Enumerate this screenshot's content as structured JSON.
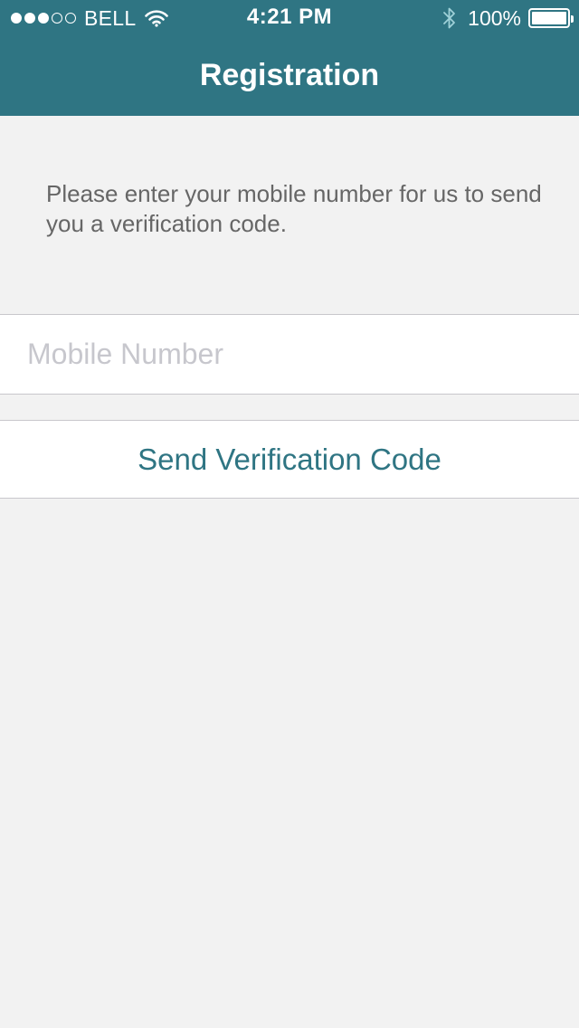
{
  "status_bar": {
    "carrier": "BELL",
    "time": "4:21 PM",
    "battery_percent": "100%",
    "signal_strength": 3,
    "signal_total": 5,
    "battery_level": 1.0,
    "icons": [
      "signal-dots-icon",
      "wifi-icon",
      "bluetooth-icon",
      "battery-icon"
    ]
  },
  "nav": {
    "title": "Registration"
  },
  "instruction": {
    "text": "Please enter your mobile number for us to send you a verification code."
  },
  "form": {
    "mobile_placeholder": "Mobile Number",
    "mobile_value": ""
  },
  "actions": {
    "send_label": "Send Verification Code"
  },
  "colors": {
    "header_bg": "#2f7583",
    "accent": "#2f7583",
    "page_bg": "#f2f2f2",
    "instruction_text": "#666666",
    "placeholder": "#c7c7cd"
  }
}
